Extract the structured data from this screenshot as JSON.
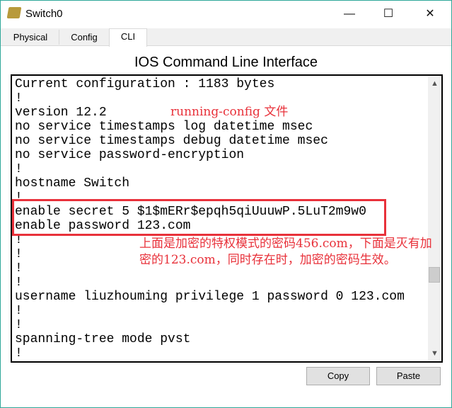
{
  "window": {
    "title": "Switch0",
    "icon": "switch-app-icon",
    "controls": {
      "minimize": "—",
      "maximize": "☐",
      "close": "✕"
    }
  },
  "tabs": [
    {
      "label": "Physical",
      "active": false
    },
    {
      "label": "Config",
      "active": false
    },
    {
      "label": "CLI",
      "active": true
    }
  ],
  "heading": "IOS Command Line Interface",
  "terminal": {
    "lines": [
      "Current configuration : 1183 bytes",
      "!",
      "version 12.2",
      "no service timestamps log datetime msec",
      "no service timestamps debug datetime msec",
      "no service password-encryption",
      "!",
      "hostname Switch",
      "!",
      "enable secret 5 $1$mERr$epqh5qiUuuwP.5LuT2m9w0",
      "enable password 123.com",
      "!",
      "!",
      "!",
      "!",
      "username liuzhouming privilege 1 password 0 123.com",
      "!",
      "!",
      "spanning-tree mode pvst",
      "!"
    ]
  },
  "annotations": {
    "running_config": "running-config 文件",
    "note": "上面是加密的特权模式的密码456.com，下面是灭有加密的123.com，同时存在时，加密的密码生效。",
    "color": "#e8313a"
  },
  "buttons": {
    "copy": "Copy",
    "paste": "Paste"
  }
}
